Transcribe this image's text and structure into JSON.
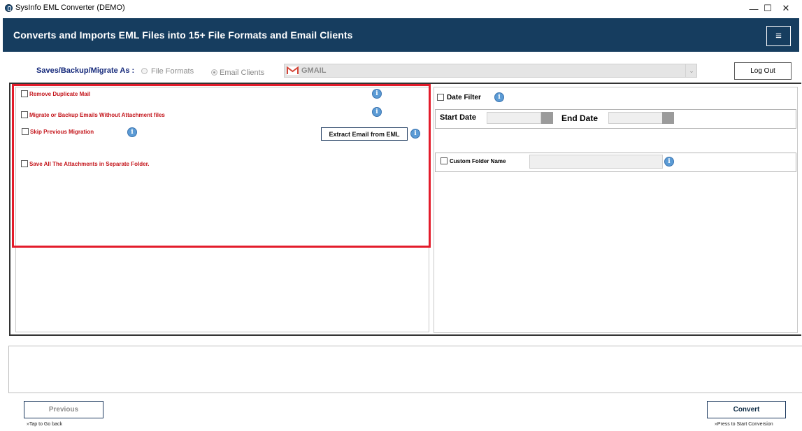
{
  "window": {
    "title": "SysInfo EML Converter (DEMO)",
    "controls": {
      "minimize": "—",
      "maximize": "☐",
      "close": "✕"
    }
  },
  "header": {
    "title": "Converts and Imports EML Files into 15+ File Formats and Email Clients",
    "menu_icon": "≡",
    "bg_color": "#163d5f"
  },
  "save_as": {
    "label": "Saves/Backup/Migrate As :",
    "options": [
      {
        "label": "File Formats",
        "selected": false
      },
      {
        "label": "Email Clients",
        "selected": true
      }
    ],
    "client_select": {
      "value": "GMAIL",
      "icon": "gmail-icon",
      "arrow": "⌄"
    }
  },
  "logout_label": "Log Out",
  "options": {
    "remove_duplicate": "Remove Duplicate Mail",
    "without_attachment": "Migrate or Backup Emails Without Attachment files",
    "skip_previous": "Skip Previous Migration",
    "save_attachments": "Save All The Attachments in Separate Folder.",
    "extract_button": "Extract Email from EML",
    "info_glyph": "i"
  },
  "date_filter": {
    "label": "Date Filter",
    "start_label": "Start Date",
    "end_label": "End Date"
  },
  "custom_folder": {
    "label": "Custom Folder Name"
  },
  "footer": {
    "previous_label": "Previous",
    "previous_hint": "»Tap to Go back",
    "convert_label": "Convert",
    "convert_hint": "»Press to Start Conversion"
  },
  "colors": {
    "accent": "#163d5f",
    "option_text": "#c4161c",
    "highlight_border": "#e31c2b",
    "info_icon": "#5b9bd5"
  }
}
